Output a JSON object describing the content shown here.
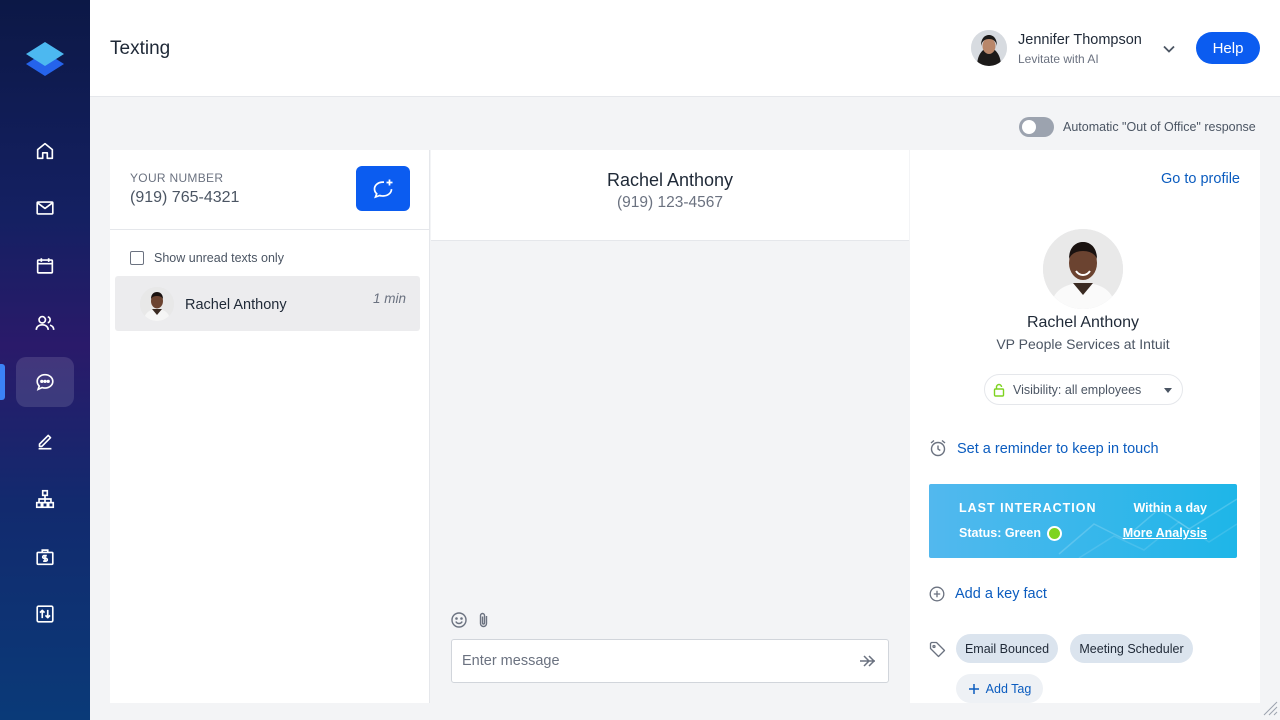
{
  "app": {
    "title": "Texting"
  },
  "user": {
    "name": "Jennifer Thompson",
    "org": "Levitate with AI"
  },
  "header": {
    "help_label": "Help"
  },
  "sidebar": {
    "items": [
      {
        "name": "home",
        "icon": "home-icon"
      },
      {
        "name": "mail",
        "icon": "mail-icon"
      },
      {
        "name": "calendar",
        "icon": "calendar-icon"
      },
      {
        "name": "contacts",
        "icon": "users-icon"
      },
      {
        "name": "texting",
        "icon": "chat-icon",
        "active": true
      },
      {
        "name": "compose",
        "icon": "pencil-icon"
      },
      {
        "name": "org",
        "icon": "hierarchy-icon"
      },
      {
        "name": "money",
        "icon": "dollar-briefcase-icon"
      },
      {
        "name": "transfer",
        "icon": "exchange-icon"
      }
    ]
  },
  "ooo": {
    "label": "Automatic \"Out of Office\" response",
    "enabled": false
  },
  "left": {
    "your_number_label": "YOUR NUMBER",
    "your_number": "(919) 765-4321",
    "unread_label": "Show unread texts only",
    "conversations": [
      {
        "name": "Rachel Anthony",
        "time": "1 min"
      }
    ]
  },
  "conversation": {
    "name": "Rachel Anthony",
    "phone": "(919) 123-4567",
    "input_placeholder": "Enter message"
  },
  "profile": {
    "go_to_profile": "Go to profile",
    "name": "Rachel Anthony",
    "title": "VP People Services at Intuit",
    "visibility": "Visibility: all employees",
    "reminder": "Set a reminder to keep in touch",
    "last_interaction": {
      "title": "LAST INTERACTION",
      "status": "Status: Green",
      "status_color": "#7ed321",
      "within": "Within a day",
      "analysis": "More Analysis"
    },
    "add_key_fact": "Add a key fact",
    "tags": [
      "Email Bounced",
      "Meeting Scheduler"
    ],
    "add_tag": "Add Tag"
  },
  "colors": {
    "accent": "#0b5cf0",
    "link": "#0b5cbf"
  }
}
